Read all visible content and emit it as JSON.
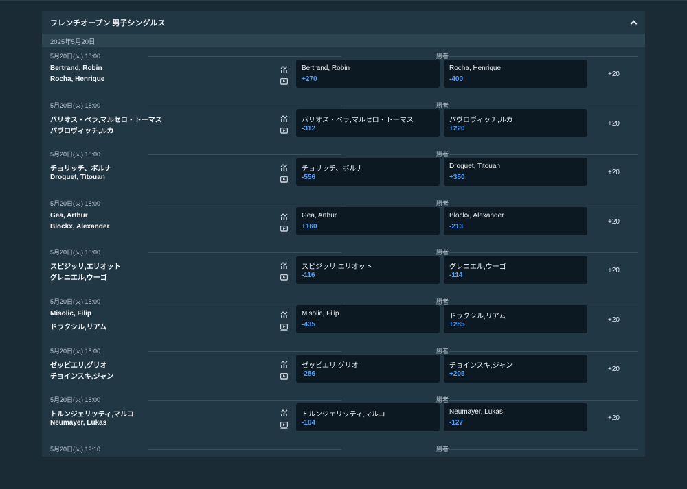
{
  "tournament": {
    "title": "フレンチオープン 男子シングルス"
  },
  "date_header": "2025年5月20日",
  "market_label": "勝者",
  "matches": [
    {
      "time": "5月20日(火) 18:00",
      "p1": "Bertrand, Robin",
      "p2": "Rocha, Henrique",
      "o1": "+270",
      "o2": "-400",
      "more": "+20"
    },
    {
      "time": "5月20日(火) 18:00",
      "p1": "バリオス・ベラ,マルセロ・トーマス",
      "p2": "パヴロヴィッチ,ルカ",
      "o1": "-312",
      "o2": "+220",
      "more": "+20"
    },
    {
      "time": "5月20日(火) 18:00",
      "p1": "チョリッチ、ボルナ",
      "p2": "Droguet, Titouan",
      "o1": "-556",
      "o2": "+350",
      "more": "+20"
    },
    {
      "time": "5月20日(火) 18:00",
      "p1": "Gea, Arthur",
      "p2": "Blockx, Alexander",
      "o1": "+160",
      "o2": "-213",
      "more": "+20"
    },
    {
      "time": "5月20日(火) 18:00",
      "p1": "スピジッリ,エリオット",
      "p2": "グレニエル,ウーゴ",
      "o1": "-116",
      "o2": "-114",
      "more": "+20"
    },
    {
      "time": "5月20日(火) 18:00",
      "p1": "Misolic, Filip",
      "p2": "ドラクシル,リアム",
      "o1": "-435",
      "o2": "+285",
      "more": "+20"
    },
    {
      "time": "5月20日(火) 18:00",
      "p1": "ゼッピエリ,グリオ",
      "p2": "チョインスキ,ジャン",
      "o1": "-286",
      "o2": "+205",
      "more": "+20"
    },
    {
      "time": "5月20日(火) 18:00",
      "p1": "トルンジェリッティ,マルコ",
      "p2": "Neumayer, Lukas",
      "o1": "-104",
      "o2": "-127",
      "more": "+20"
    },
    {
      "time": "5月20日(火) 19:10",
      "p1": "",
      "p2": "",
      "o1": "",
      "o2": "",
      "more": ""
    }
  ]
}
